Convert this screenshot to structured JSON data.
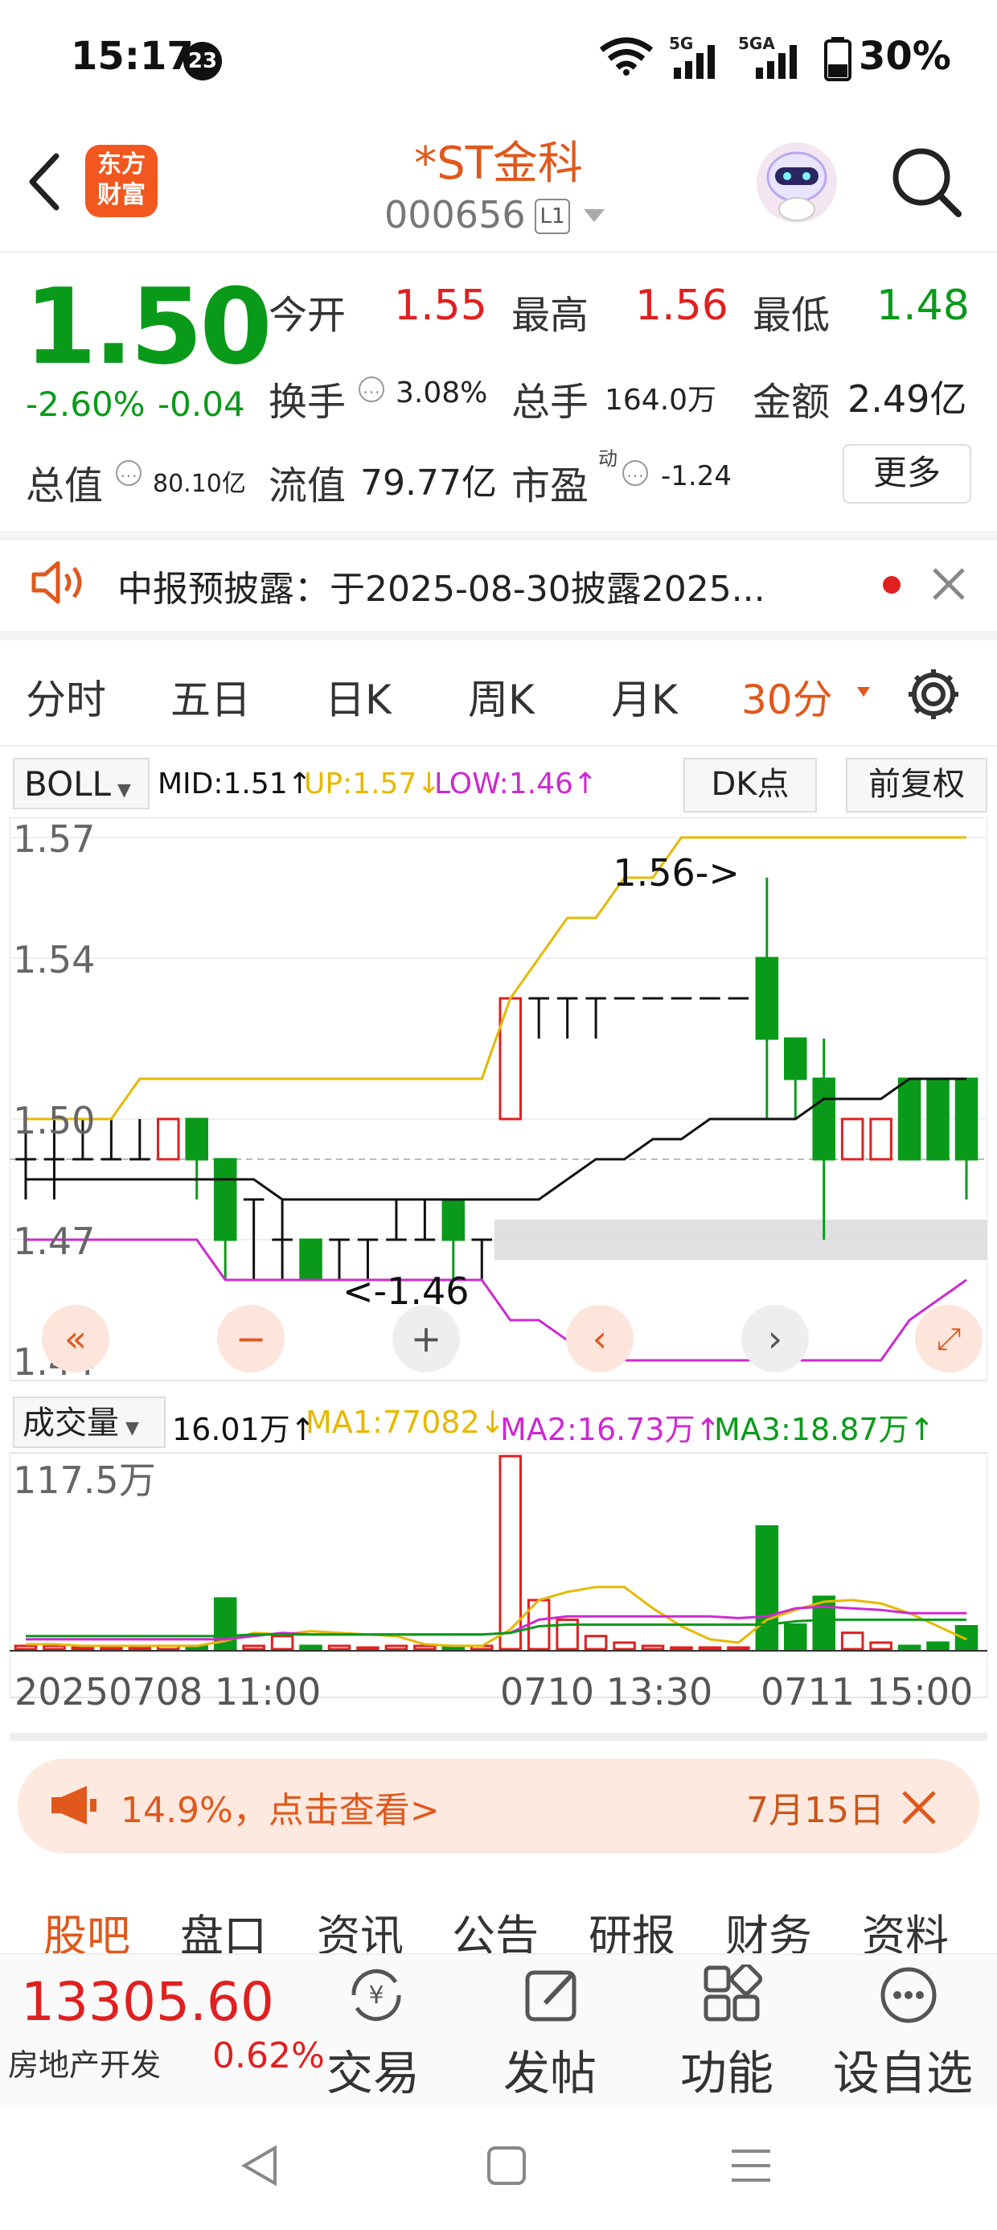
{
  "status_bar": {
    "time": "15:17",
    "notification_count": "23",
    "battery": "30%",
    "network_1": "5G",
    "network_2": "5GA"
  },
  "header": {
    "title": "*ST金科",
    "code": "000656",
    "level": "L1",
    "logo_line1": "东方",
    "logo_line2": "财富"
  },
  "quote": {
    "price": "1.50",
    "change_pct": "-2.60%",
    "change_abs": "-0.04",
    "open_label": "今开",
    "open": "1.55",
    "high_label": "最高",
    "high": "1.56",
    "low_label": "最低",
    "low": "1.48",
    "turnover_label": "换手",
    "turnover": "3.08%",
    "volume_label": "总手",
    "volume": "164.0万",
    "amount_label": "金额",
    "amount": "2.49亿",
    "mktcap_label": "总值",
    "mktcap": "80.10亿",
    "float_label": "流值",
    "float_cap": "79.77亿",
    "pe_label": "市盈",
    "pe_sup": "动",
    "pe": "-1.24",
    "more_label": "更多"
  },
  "notice": {
    "text": "中报预披露：于2025-08-30披露2025..."
  },
  "chart_tabs": {
    "items": [
      "分时",
      "五日",
      "日K",
      "周K",
      "月K"
    ],
    "active": "30分"
  },
  "indicator": {
    "name": "BOLL",
    "mid": "MID:1.51↑",
    "up": "UP:1.57↓",
    "low": "LOW:1.46↑",
    "dk_label": "DK点",
    "adjust_label": "前复权"
  },
  "chart_data": [
    {
      "type": "candlestick",
      "ylabels": [
        "1.57",
        "1.54",
        "1.50",
        "1.47",
        "1.44"
      ],
      "annotations": [
        "1.56->",
        "<-1.46"
      ],
      "candles": [
        {
          "o": 1.49,
          "c": 1.49,
          "h": 1.5,
          "l": 1.48
        },
        {
          "o": 1.49,
          "c": 1.49,
          "h": 1.5,
          "l": 1.48
        },
        {
          "o": 1.49,
          "c": 1.49,
          "h": 1.5,
          "l": 1.49
        },
        {
          "o": 1.49,
          "c": 1.49,
          "h": 1.5,
          "l": 1.49
        },
        {
          "o": 1.49,
          "c": 1.49,
          "h": 1.5,
          "l": 1.49
        },
        {
          "o": 1.49,
          "c": 1.5,
          "h": 1.5,
          "l": 1.49
        },
        {
          "o": 1.5,
          "c": 1.49,
          "h": 1.5,
          "l": 1.48
        },
        {
          "o": 1.49,
          "c": 1.47,
          "h": 1.49,
          "l": 1.46
        },
        {
          "o": 1.48,
          "c": 1.48,
          "h": 1.48,
          "l": 1.46
        },
        {
          "o": 1.47,
          "c": 1.47,
          "h": 1.48,
          "l": 1.46
        },
        {
          "o": 1.47,
          "c": 1.46,
          "h": 1.47,
          "l": 1.46
        },
        {
          "o": 1.47,
          "c": 1.47,
          "h": 1.47,
          "l": 1.46
        },
        {
          "o": 1.47,
          "c": 1.47,
          "h": 1.47,
          "l": 1.46
        },
        {
          "o": 1.47,
          "c": 1.47,
          "h": 1.48,
          "l": 1.47
        },
        {
          "o": 1.47,
          "c": 1.47,
          "h": 1.48,
          "l": 1.47
        },
        {
          "o": 1.48,
          "c": 1.47,
          "h": 1.48,
          "l": 1.46
        },
        {
          "o": 1.47,
          "c": 1.47,
          "h": 1.47,
          "l": 1.46
        },
        {
          "o": 1.5,
          "c": 1.53,
          "h": 1.53,
          "l": 1.5
        },
        {
          "o": 1.53,
          "c": 1.53,
          "h": 1.53,
          "l": 1.52
        },
        {
          "o": 1.53,
          "c": 1.53,
          "h": 1.53,
          "l": 1.52
        },
        {
          "o": 1.53,
          "c": 1.53,
          "h": 1.53,
          "l": 1.52
        },
        {
          "o": 1.53,
          "c": 1.53,
          "h": 1.53,
          "l": 1.53
        },
        {
          "o": 1.53,
          "c": 1.53,
          "h": 1.53,
          "l": 1.53
        },
        {
          "o": 1.53,
          "c": 1.53,
          "h": 1.53,
          "l": 1.53
        },
        {
          "o": 1.53,
          "c": 1.53,
          "h": 1.53,
          "l": 1.53
        },
        {
          "o": 1.53,
          "c": 1.53,
          "h": 1.53,
          "l": 1.53
        },
        {
          "o": 1.54,
          "c": 1.52,
          "h": 1.56,
          "l": 1.5
        },
        {
          "o": 1.52,
          "c": 1.51,
          "h": 1.52,
          "l": 1.5
        },
        {
          "o": 1.51,
          "c": 1.49,
          "h": 1.52,
          "l": 1.47
        },
        {
          "o": 1.49,
          "c": 1.5,
          "h": 1.5,
          "l": 1.49
        },
        {
          "o": 1.49,
          "c": 1.5,
          "h": 1.5,
          "l": 1.49
        },
        {
          "o": 1.51,
          "c": 1.49,
          "h": 1.51,
          "l": 1.49
        },
        {
          "o": 1.51,
          "c": 1.49,
          "h": 1.51,
          "l": 1.49
        },
        {
          "o": 1.51,
          "c": 1.49,
          "h": 1.51,
          "l": 1.48
        }
      ],
      "boll_up": [
        1.5,
        1.5,
        1.5,
        1.5,
        1.51,
        1.51,
        1.51,
        1.51,
        1.51,
        1.51,
        1.51,
        1.51,
        1.51,
        1.51,
        1.51,
        1.51,
        1.51,
        1.53,
        1.54,
        1.55,
        1.55,
        1.56,
        1.56,
        1.57,
        1.57,
        1.57,
        1.57,
        1.57,
        1.57,
        1.57,
        1.57,
        1.57,
        1.57,
        1.57
      ],
      "boll_mid": [
        1.485,
        1.485,
        1.485,
        1.485,
        1.485,
        1.485,
        1.485,
        1.485,
        1.485,
        1.48,
        1.48,
        1.48,
        1.48,
        1.48,
        1.48,
        1.48,
        1.48,
        1.48,
        1.48,
        1.485,
        1.49,
        1.49,
        1.495,
        1.495,
        1.5,
        1.5,
        1.5,
        1.5,
        1.505,
        1.505,
        1.505,
        1.51,
        1.51,
        1.51
      ],
      "boll_low": [
        1.47,
        1.47,
        1.47,
        1.47,
        1.47,
        1.47,
        1.47,
        1.46,
        1.46,
        1.46,
        1.46,
        1.46,
        1.46,
        1.46,
        1.46,
        1.46,
        1.46,
        1.45,
        1.45,
        1.445,
        1.445,
        1.44,
        1.44,
        1.44,
        1.44,
        1.44,
        1.44,
        1.44,
        1.44,
        1.44,
        1.44,
        1.45,
        1.455,
        1.46
      ]
    },
    {
      "type": "bar",
      "ylabel": "117.5万",
      "values": [
        2,
        2,
        1,
        1,
        1,
        2,
        2,
        31,
        2,
        8,
        2,
        2,
        1,
        2,
        2,
        2,
        2,
        118,
        30,
        18,
        8,
        4,
        2,
        1,
        1,
        1,
        75,
        15,
        32,
        10,
        4,
        2,
        4,
        14
      ],
      "ma1": [
        3,
        3,
        2,
        2,
        2,
        2,
        2,
        5,
        10,
        9,
        11,
        10,
        9,
        8,
        3,
        2,
        2,
        12,
        30,
        35,
        38,
        38,
        25,
        14,
        6,
        4,
        18,
        24,
        29,
        30,
        28,
        22,
        14,
        6
      ],
      "ma2": [
        6,
        6,
        6,
        6,
        6,
        6,
        6,
        6,
        8,
        10,
        9,
        9,
        9,
        9,
        9,
        9,
        9,
        10,
        18,
        20,
        20,
        20,
        20,
        20,
        20,
        19,
        20,
        25,
        26,
        25,
        24,
        22,
        22,
        22
      ],
      "ma3": [
        8,
        8,
        8,
        8,
        8,
        8,
        8,
        8,
        9,
        9,
        9,
        9,
        9,
        9,
        9,
        9,
        9,
        10,
        14,
        15,
        15,
        15,
        15,
        15,
        15,
        15,
        15,
        17,
        18,
        18,
        18,
        18,
        18,
        18
      ]
    }
  ],
  "volume": {
    "label": "成交量",
    "value": "16.01万↑",
    "ma1": "MA1:77082↓",
    "ma2": "MA2:16.73万↑",
    "ma3": "MA3:18.87万↑"
  },
  "x_axis": [
    "20250708 11:00",
    "0710 13:30",
    "0711 15:00"
  ],
  "promo": {
    "text": "14.9%，点击查看>",
    "date": "7月15日"
  },
  "bottom_tabs": [
    "股吧",
    "盘口",
    "资讯",
    "公告",
    "研报",
    "财务",
    "资料"
  ],
  "bottom_bar": {
    "index_value": "13305.60",
    "index_name": "房地产开发",
    "index_pct": "0.62%",
    "actions": [
      {
        "label": "交易",
        "icon": "trade-yen-icon"
      },
      {
        "label": "发帖",
        "icon": "edit-post-icon"
      },
      {
        "label": "功能",
        "icon": "grid-functions-icon"
      },
      {
        "label": "设自选",
        "icon": "more-dots-icon"
      }
    ]
  },
  "colors": {
    "up": "#e02020",
    "down": "#0a9a1a",
    "accent": "#e0581c",
    "boll_up": "#e6b800",
    "boll_mid": "#111111",
    "boll_low": "#cc2ad0"
  }
}
